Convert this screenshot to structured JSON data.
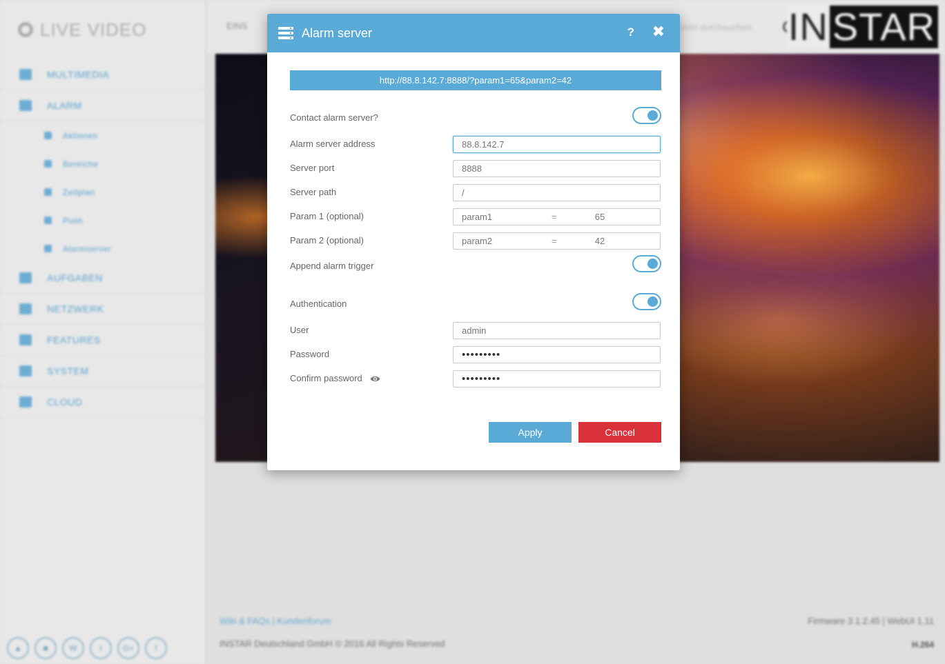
{
  "background": {
    "brand": "LIVE VIDEO",
    "nav": [
      {
        "label": "MULTIMEDIA",
        "sub": false
      },
      {
        "label": "ALARM",
        "sub": false
      },
      {
        "label": "Aktionen",
        "sub": true
      },
      {
        "label": "Bereiche",
        "sub": true
      },
      {
        "label": "Zeitplan",
        "sub": true
      },
      {
        "label": "Push",
        "sub": true
      },
      {
        "label": "Alarmserver",
        "sub": true
      },
      {
        "label": "AUFGABEN",
        "sub": false
      },
      {
        "label": "NETZWERK",
        "sub": false
      },
      {
        "label": "FEATURES",
        "sub": false
      },
      {
        "label": "SYSTEM",
        "sub": false
      },
      {
        "label": "CLOUD",
        "sub": false
      }
    ],
    "top_tab": "EINS",
    "search_placeholder": "Wiki durchsuchen",
    "logo_left": "IN",
    "logo_right": "STAR",
    "footer_links": "Wiki & FAQs | Kundenforum",
    "footer_copyright": "INSTAR Deutschland GmbH © 2016 All Rights Reserved",
    "footer_firmware": "Firmware 3.1.2.45 | WebUI 1.11",
    "footer_codec": "H.264"
  },
  "modal": {
    "title": "Alarm server",
    "help_label": "?",
    "close_label": "✖",
    "url_preview": "http://88.8.142.7:8888/?param1=65&param2=42",
    "contact_label": "Contact alarm server?",
    "contact_enabled": true,
    "address_label": "Alarm server address",
    "address_value": "88.8.142.7",
    "port_label": "Server port",
    "port_value": "8888",
    "path_label": "Server path",
    "path_value": "/",
    "param1_label": "Param 1 (optional)",
    "param1_key": "param1",
    "param1_eq": "=",
    "param1_value": "65",
    "param2_label": "Param 2 (optional)",
    "param2_key": "param2",
    "param2_eq": "=",
    "param2_value": "42",
    "append_label": "Append alarm trigger",
    "append_enabled": true,
    "auth_label": "Authentication",
    "auth_enabled": true,
    "user_label": "User",
    "user_value": "admin",
    "password_label": "Password",
    "password_value": "•••••••••",
    "confirm_label": "Confirm password",
    "confirm_value": "•••••••••",
    "apply_label": "Apply",
    "cancel_label": "Cancel"
  },
  "colors": {
    "accent": "#5aaad8",
    "danger": "#d9323a"
  }
}
